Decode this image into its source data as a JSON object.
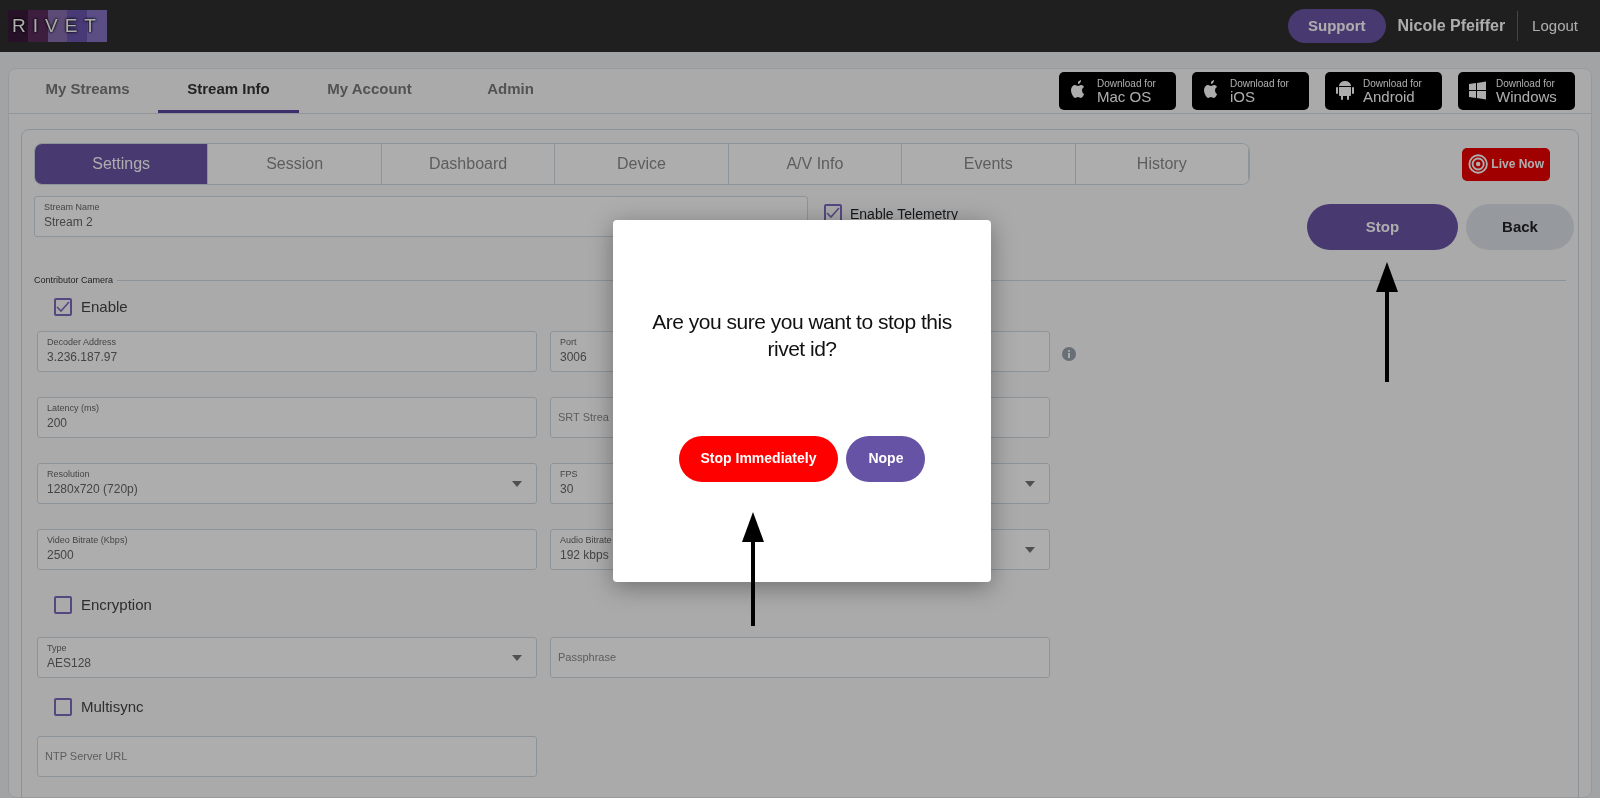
{
  "top_bar": {
    "logo": "RIVET",
    "support_button": "Support",
    "user_name": "Nicole Pfeiffer",
    "logout": "Logout"
  },
  "nav_tabs": [
    {
      "label": "My Streams",
      "selected": false
    },
    {
      "label": "Stream Info",
      "selected": true
    },
    {
      "label": "My Account",
      "selected": false
    },
    {
      "label": "Admin",
      "selected": false
    }
  ],
  "downloads": [
    {
      "kind": "apple",
      "line1": "Download for",
      "line2": "Mac OS"
    },
    {
      "kind": "apple",
      "line1": "Download for",
      "line2": "iOS"
    },
    {
      "kind": "android",
      "line1": "Download for",
      "line2": "Android"
    },
    {
      "kind": "windows",
      "line1": "Download for",
      "line2": "Windows"
    }
  ],
  "sub_tabs": [
    {
      "label": "Settings",
      "selected": true
    },
    {
      "label": "Session",
      "selected": false
    },
    {
      "label": "Dashboard",
      "selected": false
    },
    {
      "label": "Device",
      "selected": false
    },
    {
      "label": "A/V Info",
      "selected": false
    },
    {
      "label": "Events",
      "selected": false
    },
    {
      "label": "History",
      "selected": false
    }
  ],
  "live_button": "Live Now",
  "stream_name": {
    "label": "Stream Name",
    "value": "Stream 2"
  },
  "telemetry": {
    "label": "Enable Telemetry",
    "checked": true
  },
  "actions": [
    {
      "label": "Stop",
      "kind": "primary"
    },
    {
      "label": "Back",
      "kind": "secondary"
    }
  ],
  "section": {
    "legend": "Contributor Camera",
    "enable": {
      "label": "Enable",
      "checked": true
    },
    "fields": [
      {
        "kind": "text",
        "label": "Decoder Address",
        "value": "3.236.187.97"
      },
      {
        "kind": "text",
        "label": "Port",
        "value": "3006"
      },
      {
        "kind": "text",
        "label": "Latency (ms)",
        "value": "200"
      },
      {
        "kind": "text",
        "placeholder": "SRT Strea"
      },
      {
        "kind": "select",
        "label": "Resolution",
        "value": "1280x720 (720p)"
      },
      {
        "kind": "select",
        "label": "FPS",
        "value": "30"
      },
      {
        "kind": "text",
        "label": "Video Bitrate (Kbps)",
        "value": "2500"
      },
      {
        "kind": "select",
        "label": "Audio Bitrate",
        "value": "192 kbps"
      }
    ],
    "encryption": {
      "label": "Encryption",
      "checked": false
    },
    "encryption_fields": [
      {
        "kind": "select",
        "label": "Type",
        "value": "AES128"
      },
      {
        "kind": "text",
        "placeholder": "Passphrase"
      }
    ],
    "multisync": {
      "label": "Multisync",
      "checked": false
    },
    "multisync_fields": [
      {
        "kind": "text",
        "placeholder": "NTP Server URL"
      }
    ]
  },
  "modal": {
    "message": "Are you sure you want to stop this rivet id?",
    "buttons": [
      {
        "label": "Stop Immediately",
        "kind": "danger"
      },
      {
        "label": "Nope",
        "kind": "primary"
      }
    ]
  }
}
